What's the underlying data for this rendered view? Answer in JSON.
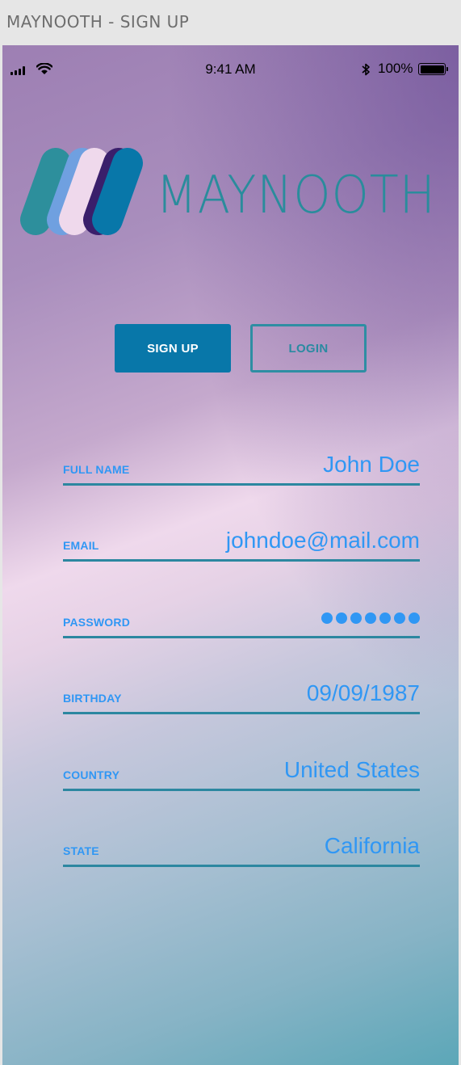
{
  "window": {
    "title": "MAYNOOTH - SIGN UP"
  },
  "status_bar": {
    "time": "9:41 AM",
    "battery": "100%"
  },
  "logo": {
    "text": "MAYNOOTH"
  },
  "buttons": {
    "signup": "SIGN UP",
    "login": "LOGIN"
  },
  "form": {
    "full_name": {
      "label": "FULL NAME",
      "value": "John Doe"
    },
    "email": {
      "label": "EMAIL",
      "value": "johndoe@mail.com"
    },
    "password": {
      "label": "PASSWORD",
      "masked_length": 7
    },
    "birthday": {
      "label": "BIRTHDAY",
      "value": "09/09/1987"
    },
    "country": {
      "label": "COUNTRY",
      "value": "United States"
    },
    "state": {
      "label": "STATE",
      "value": "California"
    }
  },
  "colors": {
    "primary": "#0877a9",
    "accent_text": "#3097f4",
    "teal": "#2a8c9c"
  },
  "icons": [
    "signal-icon",
    "wifi-icon",
    "bluetooth-icon",
    "battery-icon",
    "logo-mark-icon"
  ]
}
